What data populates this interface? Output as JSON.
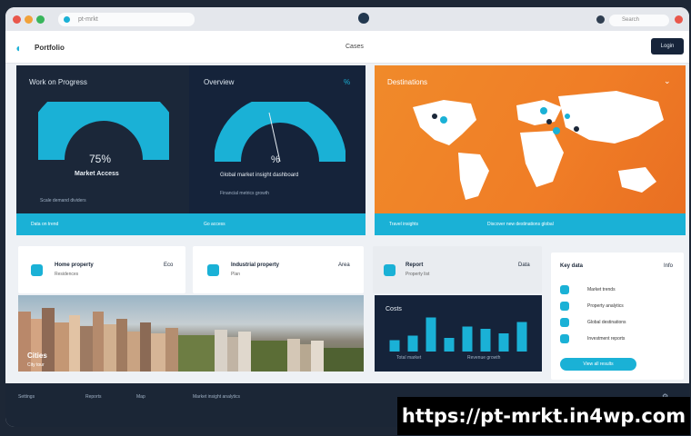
{
  "browser": {
    "tab_title": "pt-mrkt",
    "search_placeholder": "Search"
  },
  "header": {
    "brand": "Portfolio",
    "nav_link": "Cases",
    "button_label": "Login"
  },
  "gauge_left": {
    "title": "Work on Progress",
    "value": "75%",
    "caption": "Market Access",
    "footnote": "Scale demand dividers",
    "strip_label": "Data on trend",
    "progress": 0.62
  },
  "gauge_right": {
    "title": "Overview",
    "badge": "%",
    "value": "%",
    "caption": "Global market insight dashboard",
    "footnote": "Financial metrics growth",
    "strip_label": "Go access",
    "progress": 0.55
  },
  "map_card": {
    "title": "Destinations",
    "strip_left": "Travel insights",
    "strip_right": "Discover new destinations global"
  },
  "mini_card_1": {
    "title": "Home property",
    "sub": "Residences",
    "tag": "Eco"
  },
  "mini_card_2": {
    "title": "Industrial property",
    "sub": "Plan",
    "tag": "Area"
  },
  "mini_card_3": {
    "title": "Report",
    "sub": "Property list",
    "tag": "Data"
  },
  "photo_overlay": {
    "title": "Cities",
    "sub": "City tour"
  },
  "bar_chart": {
    "label": "Costs",
    "axis_left": "Total market",
    "axis_right": "Revenue growth"
  },
  "list_panel": {
    "title": "Key data",
    "tag": "Info",
    "items": [
      {
        "label": "Market trends"
      },
      {
        "label": "Property analytics"
      },
      {
        "label": "Global destinations"
      },
      {
        "label": "Investment reports"
      }
    ],
    "button_label": "View all results"
  },
  "footer": {
    "items": [
      "Settings",
      "Reports",
      "Map",
      "Market insight analytics"
    ],
    "url": "https://pt-mrkt.in4wp.com"
  },
  "chart_data": {
    "type": "bar",
    "categories": [
      "1",
      "2",
      "3",
      "4",
      "5",
      "6",
      "7",
      "8"
    ],
    "values": [
      10,
      14,
      30,
      12,
      22,
      20,
      16,
      26
    ],
    "ylim": [
      0,
      32
    ]
  },
  "colors": {
    "accent": "#1ab1d6",
    "dark": "#15233a",
    "orange": "#f08a2a"
  }
}
